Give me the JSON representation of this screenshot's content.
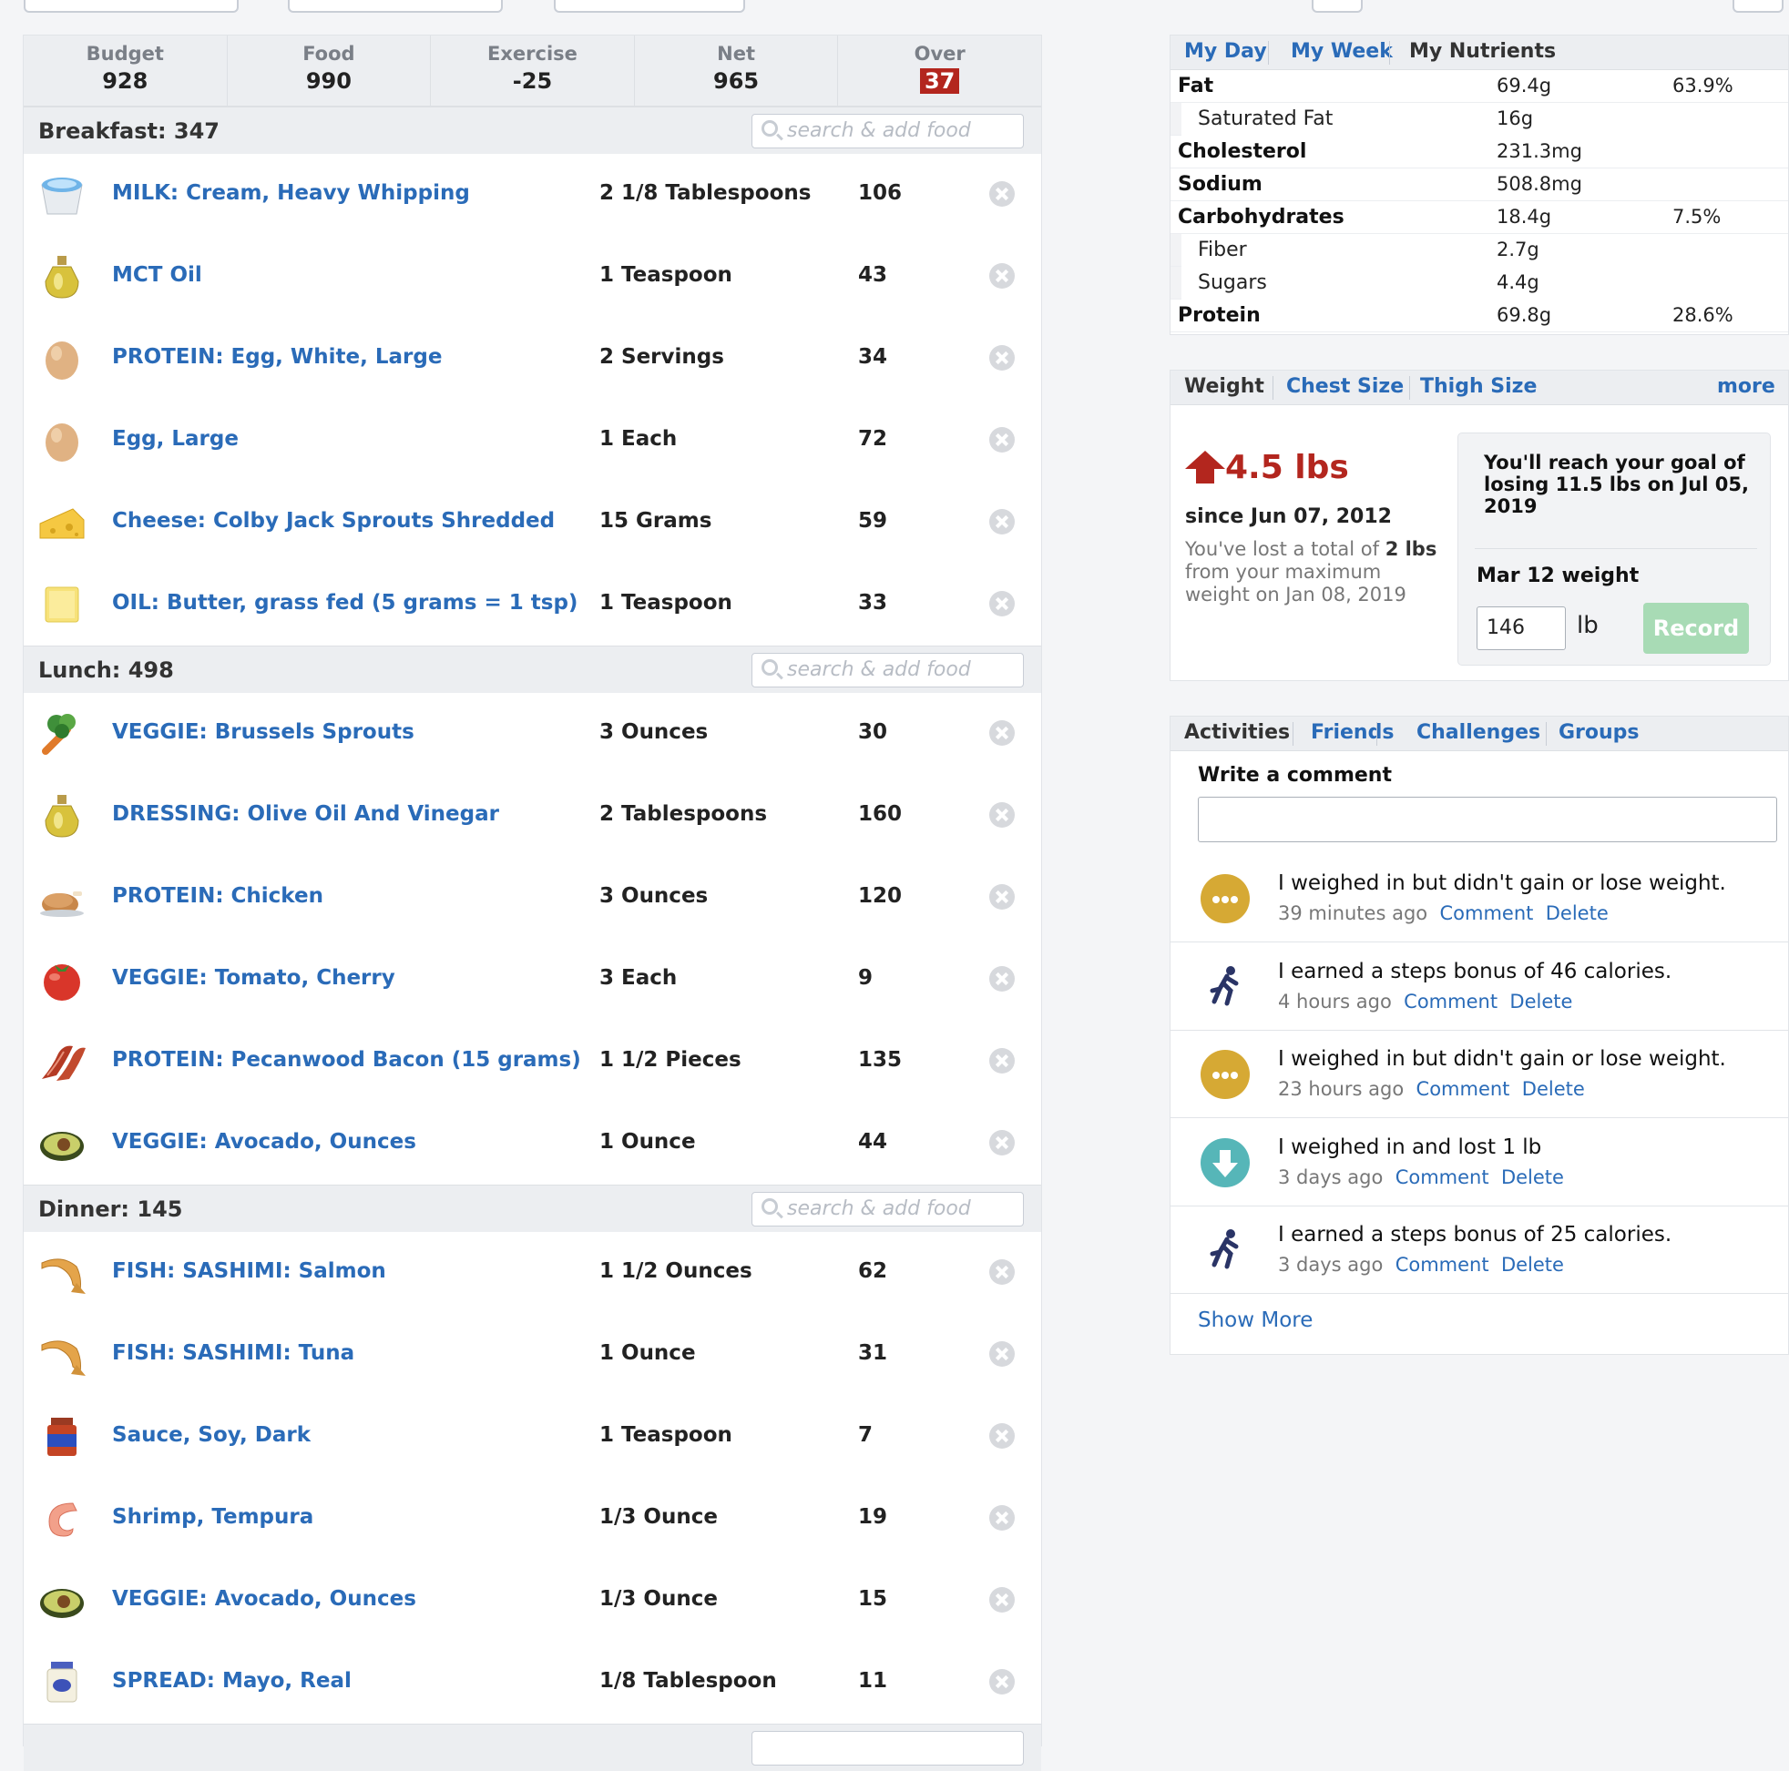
{
  "summary": {
    "budget_label": "Budget",
    "budget_value": "928",
    "food_label": "Food",
    "food_value": "990",
    "exercise_label": "Exercise",
    "exercise_value": "-25",
    "net_label": "Net",
    "net_value": "965",
    "over_label": "Over",
    "over_value": "37"
  },
  "search_placeholder": "search & add food",
  "breakfast": {
    "title": "Breakfast: 347",
    "items": [
      {
        "name": "MILK: Cream, Heavy Whipping",
        "qty": "2 1/8 Tablespoons",
        "cal": "106",
        "icon": "cream-cup-icon"
      },
      {
        "name": "MCT Oil",
        "qty": "1 Teaspoon",
        "cal": "43",
        "icon": "oil-bottle-icon"
      },
      {
        "name": "PROTEIN: Egg, White, Large",
        "qty": "2 Servings",
        "cal": "34",
        "icon": "egg-icon"
      },
      {
        "name": "Egg, Large",
        "qty": "1 Each",
        "cal": "72",
        "icon": "egg-icon"
      },
      {
        "name": "Cheese: Colby Jack Sprouts Shredded",
        "qty": "15 Grams",
        "cal": "59",
        "icon": "cheese-icon"
      },
      {
        "name": "OIL: Butter, grass fed (5 grams = 1 tsp)",
        "qty": "1 Teaspoon",
        "cal": "33",
        "icon": "butter-icon"
      }
    ]
  },
  "lunch": {
    "title": "Lunch: 498",
    "items": [
      {
        "name": "VEGGIE: Brussels Sprouts",
        "qty": "3 Ounces",
        "cal": "30",
        "icon": "vegetables-icon"
      },
      {
        "name": "DRESSING: Olive Oil And Vinegar",
        "qty": "2 Tablespoons",
        "cal": "160",
        "icon": "oil-bottle-icon"
      },
      {
        "name": "PROTEIN: Chicken",
        "qty": "3 Ounces",
        "cal": "120",
        "icon": "roast-chicken-icon"
      },
      {
        "name": "VEGGIE: Tomato, Cherry",
        "qty": "3 Each",
        "cal": "9",
        "icon": "tomato-icon"
      },
      {
        "name": "PROTEIN: Pecanwood Bacon (15 grams)",
        "qty": "1 1/2 Pieces",
        "cal": "135",
        "icon": "bacon-icon"
      },
      {
        "name": "VEGGIE: Avocado, Ounces",
        "qty": "1 Ounce",
        "cal": "44",
        "icon": "avocado-icon"
      }
    ]
  },
  "dinner": {
    "title": "Dinner: 145",
    "items": [
      {
        "name": "FISH: SASHIMI: Salmon",
        "qty": "1 1/2 Ounces",
        "cal": "62",
        "icon": "fish-icon"
      },
      {
        "name": "FISH: SASHIMI: Tuna",
        "qty": "1 Ounce",
        "cal": "31",
        "icon": "fish-icon"
      },
      {
        "name": "Sauce, Soy, Dark",
        "qty": "1 Teaspoon",
        "cal": "7",
        "icon": "sauce-jar-icon"
      },
      {
        "name": "Shrimp, Tempura",
        "qty": "1/3 Ounce",
        "cal": "19",
        "icon": "shrimp-icon"
      },
      {
        "name": "VEGGIE: Avocado, Ounces",
        "qty": "1/3 Ounce",
        "cal": "15",
        "icon": "avocado-icon"
      },
      {
        "name": "SPREAD: Mayo, Real",
        "qty": "1/8 Tablespoon",
        "cal": "11",
        "icon": "mayo-jar-icon"
      }
    ]
  },
  "nutrients": {
    "tabs": [
      "My Day",
      "My Week",
      "My Nutrients"
    ],
    "rows": [
      {
        "label": "Fat",
        "value": "69.4g",
        "pct": "63.9%",
        "sub": false
      },
      {
        "label": "Saturated Fat",
        "value": "16g",
        "pct": "",
        "sub": true
      },
      {
        "label": "Cholesterol",
        "value": "231.3mg",
        "pct": "",
        "sub": false
      },
      {
        "label": "Sodium",
        "value": "508.8mg",
        "pct": "",
        "sub": false
      },
      {
        "label": "Carbohydrates",
        "value": "18.4g",
        "pct": "7.5%",
        "sub": false
      },
      {
        "label": "Fiber",
        "value": "2.7g",
        "pct": "",
        "sub": true
      },
      {
        "label": "Sugars",
        "value": "4.4g",
        "pct": "",
        "sub": true
      },
      {
        "label": "Protein",
        "value": "69.8g",
        "pct": "28.6%",
        "sub": false
      }
    ]
  },
  "weight": {
    "tabs": [
      "Weight",
      "Chest Size",
      "Thigh Size"
    ],
    "more": "more",
    "change": "4.5 lbs",
    "since": "since Jun 07, 2012",
    "lost_pre": "You've lost a total of ",
    "lost_amount": "2 lbs",
    "lost_post": " from your maximum weight on Jan 08, 2019",
    "goal_text": "You'll reach your goal of losing 11.5 lbs on Jul 05, 2019",
    "mar_label": "Mar 12 weight",
    "input_value": "146",
    "unit": "lb",
    "record": "Record",
    "colors": {
      "gain": "#b3261e",
      "record_btn": "#a8dbb5"
    }
  },
  "activity": {
    "tabs": [
      "Activities",
      "Friends",
      "Challenges",
      "Groups"
    ],
    "write_label": "Write a comment",
    "items": [
      {
        "text": "I weighed in but didn't gain or lose weight.",
        "time": "39 minutes ago",
        "icon": "neutral-weight-icon"
      },
      {
        "text": "I earned a steps bonus of 46 calories.",
        "time": "4 hours ago",
        "icon": "runner-icon"
      },
      {
        "text": "I weighed in but didn't gain or lose weight.",
        "time": "23 hours ago",
        "icon": "neutral-weight-icon"
      },
      {
        "text": "I weighed in and lost 1 lb",
        "time": "3 days ago",
        "icon": "down-arrow-icon"
      },
      {
        "text": "I earned a steps bonus of 25 calories.",
        "time": "3 days ago",
        "icon": "runner-icon"
      }
    ],
    "comment": "Comment",
    "delete": "Delete",
    "show_more": "Show More"
  }
}
